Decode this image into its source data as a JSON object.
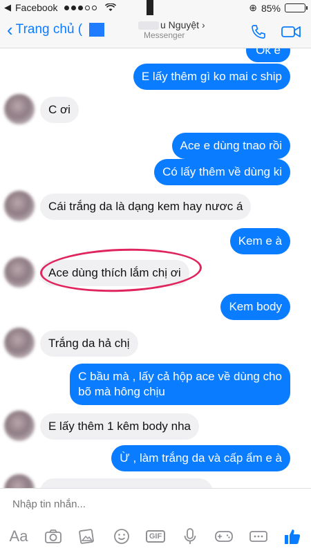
{
  "status_bar": {
    "app_back": "Facebook",
    "battery": "85%",
    "battery_fraction": 0.85
  },
  "header": {
    "back_label": "Trang chủ (",
    "contact_name": "u Nguyệt",
    "contact_sub": "Messenger"
  },
  "messages": [
    {
      "dir": "out",
      "text": "Ok e"
    },
    {
      "dir": "out",
      "text": "E lấy thêm gì ko mai c ship"
    },
    {
      "dir": "in",
      "text": "C ơi"
    },
    {
      "dir": "out",
      "text": "Ace e dùng tnao rồi"
    },
    {
      "dir": "out",
      "text": "Có lấy thêm về dùng ki"
    },
    {
      "dir": "in",
      "text": "Cái trắng da là dạng kem hay nươc á"
    },
    {
      "dir": "out",
      "text": "Kem e à"
    },
    {
      "dir": "in",
      "text": "Ace dùng thích lắm chị ơi"
    },
    {
      "dir": "out",
      "text": "Kem body"
    },
    {
      "dir": "in",
      "text": "Trắng da hả chị"
    },
    {
      "dir": "out",
      "line1": "C bầu mà , lấy cả hộp ace về dùng cho",
      "line2": "bõ mà hông chịu"
    },
    {
      "dir": "in",
      "text": "E lấy thêm 1 kêm body nha"
    },
    {
      "dir": "out",
      "text": "Ừ , làm trắng da và cấp ẩm e à"
    }
  ],
  "composer": {
    "placeholder": "Nhập tin nhắn..."
  },
  "toolbar": {
    "aa_label": "Aa",
    "gif_label": "GIF"
  }
}
